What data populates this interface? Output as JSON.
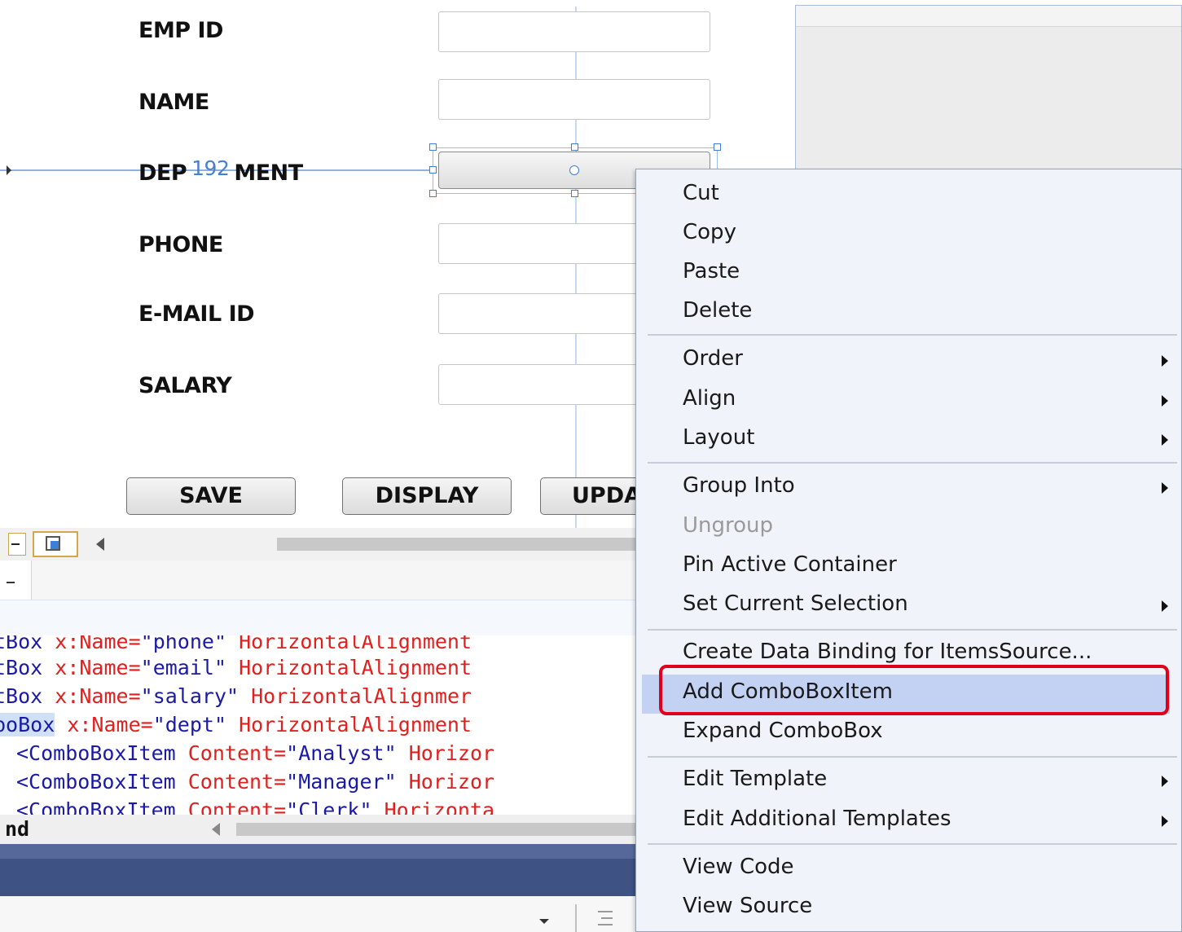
{
  "form": {
    "labels": [
      "EMP ID",
      "NAME",
      "DEP",
      "MENT",
      "PHONE",
      "E-MAIL ID",
      "SALARY"
    ],
    "dimension_readout": "192",
    "buttons": [
      "SAVE",
      "DISPLAY",
      "UPDA"
    ]
  },
  "code": {
    "lines": [
      {
        "prefix": "tBox",
        "attr": "x:Name=",
        "val": "\"phone\"",
        "tail": "HorizontalAlignment"
      },
      {
        "prefix": "tBox",
        "attr": "x:Name=",
        "val": "\"email\"",
        "tail": "HorizontalAlignment"
      },
      {
        "prefix": "tBox",
        "attr": "x:Name=",
        "val": "\"salary\"",
        "tail": "HorizontalAlignmer"
      },
      {
        "prefix": "boBox",
        "attr": "x:Name=",
        "val": "\"dept\"",
        "tail": "HorizontalAlignment"
      },
      {
        "prefix": "<ComboBoxItem",
        "attr": "Content=",
        "val": "\"Analyst\"",
        "tail": "Horizor"
      },
      {
        "prefix": "<ComboBoxItem",
        "attr": "Content=",
        "val": "\"Manager\"",
        "tail": "Horizor"
      },
      {
        "prefix": "<ComboBoxItem",
        "attr": "Content=",
        "val": "\"Clerk\"",
        "tail": "Horizonta"
      }
    ],
    "status_text": "nd"
  },
  "context_menu": {
    "items": [
      {
        "label": "Cut"
      },
      {
        "label": "Copy"
      },
      {
        "label": "Paste"
      },
      {
        "label": "Delete"
      },
      {
        "label": "Order"
      },
      {
        "label": "Align"
      },
      {
        "label": "Layout"
      },
      {
        "label": "Group Into"
      },
      {
        "label": "Ungroup"
      },
      {
        "label": "Pin Active Container"
      },
      {
        "label": "Set Current Selection"
      },
      {
        "label": "Create Data Binding for ItemsSource..."
      },
      {
        "label": "Add ComboBoxItem"
      },
      {
        "label": "Expand ComboBox"
      },
      {
        "label": "Edit Template"
      },
      {
        "label": "Edit Additional Templates"
      },
      {
        "label": "View Code"
      },
      {
        "label": "View Source"
      }
    ],
    "highlighted": "Add ComboBoxItem",
    "disabled": [
      "Ungroup"
    ]
  },
  "colors": {
    "selection_accent": "#3d7fd9",
    "highlight": "#c3d2f3",
    "callout_red": "#e0001a",
    "code_keyword": "#1a1aa6",
    "code_attr": "#e0201f",
    "status_navy": "#3e5283"
  }
}
